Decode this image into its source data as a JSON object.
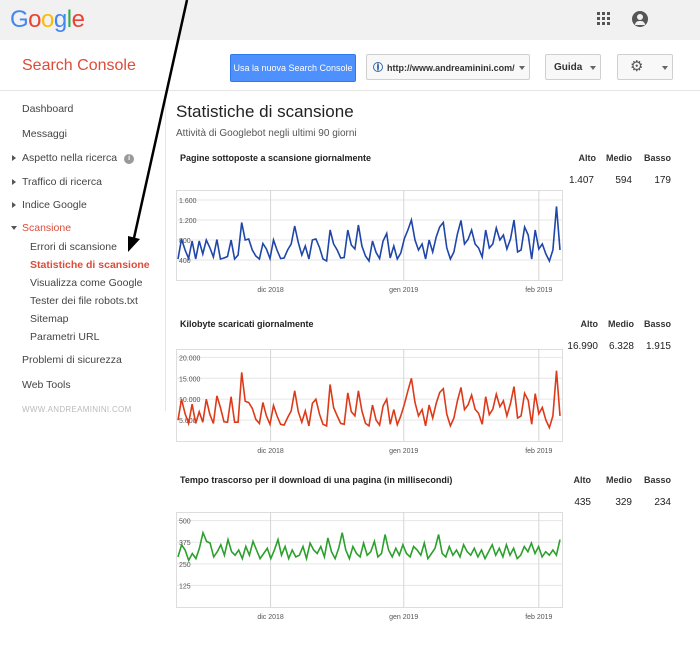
{
  "google_logo": [
    "G",
    "o",
    "o",
    "g",
    "l",
    "e"
  ],
  "header": {
    "product": "Search Console",
    "new_console_button": "Usa la nuova Search Console",
    "site": "http://www.andreaminini.com/",
    "help": "Guida"
  },
  "sidebar": {
    "items": [
      {
        "label": "Dashboard"
      },
      {
        "label": "Messaggi"
      },
      {
        "label": "Aspetto nella ricerca"
      },
      {
        "label": "Traffico di ricerca"
      },
      {
        "label": "Indice Google"
      },
      {
        "label": "Scansione"
      },
      {
        "label": "Errori di scansione"
      },
      {
        "label": "Statistiche di scansione"
      },
      {
        "label": "Visualizza come Google"
      },
      {
        "label": "Tester dei file robots.txt"
      },
      {
        "label": "Sitemap"
      },
      {
        "label": "Parametri URL"
      },
      {
        "label": "Problemi di sicurezza"
      },
      {
        "label": "Web Tools"
      }
    ],
    "watermark": "WWW.ANDREAMININI.COM"
  },
  "main": {
    "title": "Statistiche di scansione",
    "subtitle": "Attività di Googlebot negli ultimi 90 giorni"
  },
  "stat_labels": {
    "high": "Alto",
    "mid": "Medio",
    "low": "Basso"
  },
  "colors": {
    "pages": "#1f46a8",
    "kb": "#dd3a1a",
    "time": "#2ca02c",
    "brand_red": "#dd4b39",
    "button_blue": "#4d90fe"
  },
  "chart_data": [
    {
      "type": "line",
      "title": "Pagine sottoposte a scansione giornalmente",
      "stats": {
        "high": "1.407",
        "mid": "594",
        "low": "179"
      },
      "yticks": [
        "1.600",
        "1.200",
        "800",
        "400"
      ],
      "ylim": [
        0,
        1800
      ],
      "xticks": [
        "dic 2018",
        "gen 2019",
        "feb 2019"
      ],
      "values": [
        420,
        820,
        600,
        430,
        780,
        420,
        780,
        520,
        800,
        650,
        460,
        810,
        420,
        440,
        470,
        800,
        420,
        500,
        1150,
        800,
        820,
        600,
        480,
        420,
        730,
        620,
        430,
        800,
        600,
        430,
        440,
        600,
        720,
        1080,
        750,
        500,
        680,
        420,
        800,
        820,
        650,
        420,
        380,
        1000,
        720,
        600,
        440,
        450,
        1000,
        700,
        620,
        1100,
        680,
        480,
        380,
        780,
        550,
        430,
        780,
        930,
        440,
        680,
        420,
        540,
        830,
        1000,
        1200,
        800,
        600,
        720,
        420,
        800,
        560,
        860,
        1060,
        1150,
        640,
        420,
        560,
        920,
        1190,
        720,
        810,
        1000,
        720,
        640,
        460,
        1000,
        640,
        720,
        1040,
        800,
        900,
        620,
        820,
        1200,
        560,
        600,
        1060,
        900,
        420,
        1000,
        620,
        720,
        520,
        380,
        600,
        1470,
        600
      ]
    },
    {
      "type": "line",
      "title": "Kilobyte scaricati giornalmente",
      "stats": {
        "high": "16.990",
        "mid": "6.328",
        "low": "1.915"
      },
      "yticks": [
        "20.000",
        "15.000",
        "10.000",
        "5.000"
      ],
      "ylim": [
        0,
        22000
      ],
      "xticks": [
        "dic 2018",
        "gen 2019",
        "feb 2019"
      ],
      "values": [
        5000,
        10000,
        6500,
        4200,
        8800,
        4200,
        7000,
        4500,
        10000,
        6400,
        4200,
        10800,
        8000,
        4600,
        4500,
        10600,
        4500,
        4500,
        16400,
        9500,
        9200,
        7800,
        5200,
        4200,
        9200,
        6000,
        4000,
        8500,
        6000,
        4000,
        3800,
        5600,
        7200,
        12000,
        7000,
        4500,
        7200,
        3600,
        9000,
        10000,
        6400,
        4000,
        3600,
        13500,
        8000,
        6000,
        4200,
        4000,
        11500,
        7000,
        6000,
        12000,
        7200,
        4200,
        3600,
        8600,
        5000,
        3800,
        8400,
        10000,
        4000,
        7500,
        3900,
        6000,
        8800,
        12000,
        15000,
        9200,
        6000,
        7500,
        3600,
        8600,
        5500,
        9000,
        11600,
        12500,
        6400,
        3600,
        5500,
        9600,
        12800,
        7500,
        8600,
        11000,
        7600,
        6600,
        4000,
        10600,
        6300,
        7600,
        11200,
        8200,
        9600,
        6000,
        9000,
        13000,
        5500,
        6000,
        11400,
        9700,
        4000,
        11300,
        6500,
        8000,
        5000,
        3200,
        6000,
        16800,
        6000
      ]
    },
    {
      "type": "line",
      "title": "Tempo trascorso per il download di una pagina (in millisecondi)",
      "stats": {
        "high": "435",
        "mid": "329",
        "low": "234"
      },
      "yticks": [
        "500",
        "375",
        "250",
        "125"
      ],
      "ylim": [
        0,
        550
      ],
      "xticks": [
        "dic 2018",
        "gen 2019",
        "feb 2019"
      ],
      "values": [
        290,
        360,
        330,
        270,
        310,
        280,
        340,
        430,
        380,
        370,
        290,
        320,
        360,
        300,
        390,
        320,
        300,
        330,
        280,
        350,
        300,
        380,
        330,
        280,
        310,
        340,
        280,
        330,
        390,
        300,
        350,
        280,
        330,
        290,
        300,
        350,
        280,
        370,
        330,
        310,
        350,
        290,
        400,
        320,
        280,
        340,
        430,
        330,
        280,
        350,
        310,
        290,
        370,
        300,
        320,
        380,
        290,
        310,
        420,
        330,
        290,
        340,
        300,
        360,
        310,
        290,
        350,
        330,
        300,
        370,
        280,
        310,
        340,
        420,
        310,
        290,
        350,
        300,
        330,
        290,
        360,
        320,
        300,
        340,
        290,
        330,
        280,
        320,
        360,
        300,
        340,
        290,
        360,
        300,
        340,
        280,
        300,
        350,
        320,
        370,
        310,
        350,
        290,
        320,
        300,
        330,
        300,
        390
      ]
    }
  ]
}
